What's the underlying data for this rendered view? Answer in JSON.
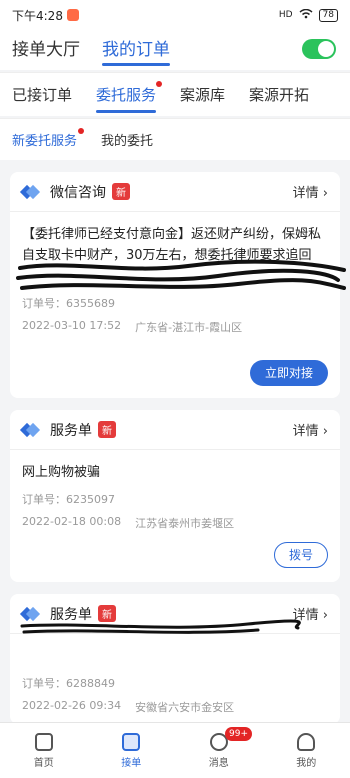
{
  "status_bar": {
    "time": "下午4:28",
    "signal": "HD",
    "battery": "78"
  },
  "top_tabs": [
    {
      "label": "接单大厅"
    },
    {
      "label": "我的订单"
    }
  ],
  "sub_tabs": [
    {
      "label": "已接订单"
    },
    {
      "label": "委托服务"
    },
    {
      "label": "案源库"
    },
    {
      "label": "案源开拓"
    }
  ],
  "third_tabs": [
    {
      "label": "新委托服务"
    },
    {
      "label": "我的委托"
    }
  ],
  "orders": [
    {
      "type": "微信咨询",
      "badge": "新",
      "detail": "详情",
      "description": "【委托律师已经支付意向金】返还财产纠纷，保姆私自支取卡中财产，30万左右，想委托律师要求追回",
      "order_label": "订单号：",
      "order_no": "6355689",
      "datetime": "2022-03-10 17:52",
      "region": "广东省-湛江市-霞山区",
      "action": "立即对接"
    },
    {
      "type": "服务单",
      "badge": "新",
      "detail": "详情",
      "description": "网上购物被骗",
      "order_label": "订单号：",
      "order_no": "6235097",
      "datetime": "2022-02-18 00:08",
      "region": "江苏省泰州市姜堰区",
      "action": "拨号"
    },
    {
      "type": "服务单",
      "badge": "新",
      "detail": "详情",
      "description": "",
      "order_label": "订单号：",
      "order_no": "6288849",
      "datetime": "2022-02-26 09:34",
      "region": "安徽省六安市金安区",
      "action": ""
    }
  ],
  "bottom_nav": [
    {
      "label": "首页"
    },
    {
      "label": "接单"
    },
    {
      "label": "消息",
      "badge": "99+"
    },
    {
      "label": "我的"
    }
  ]
}
